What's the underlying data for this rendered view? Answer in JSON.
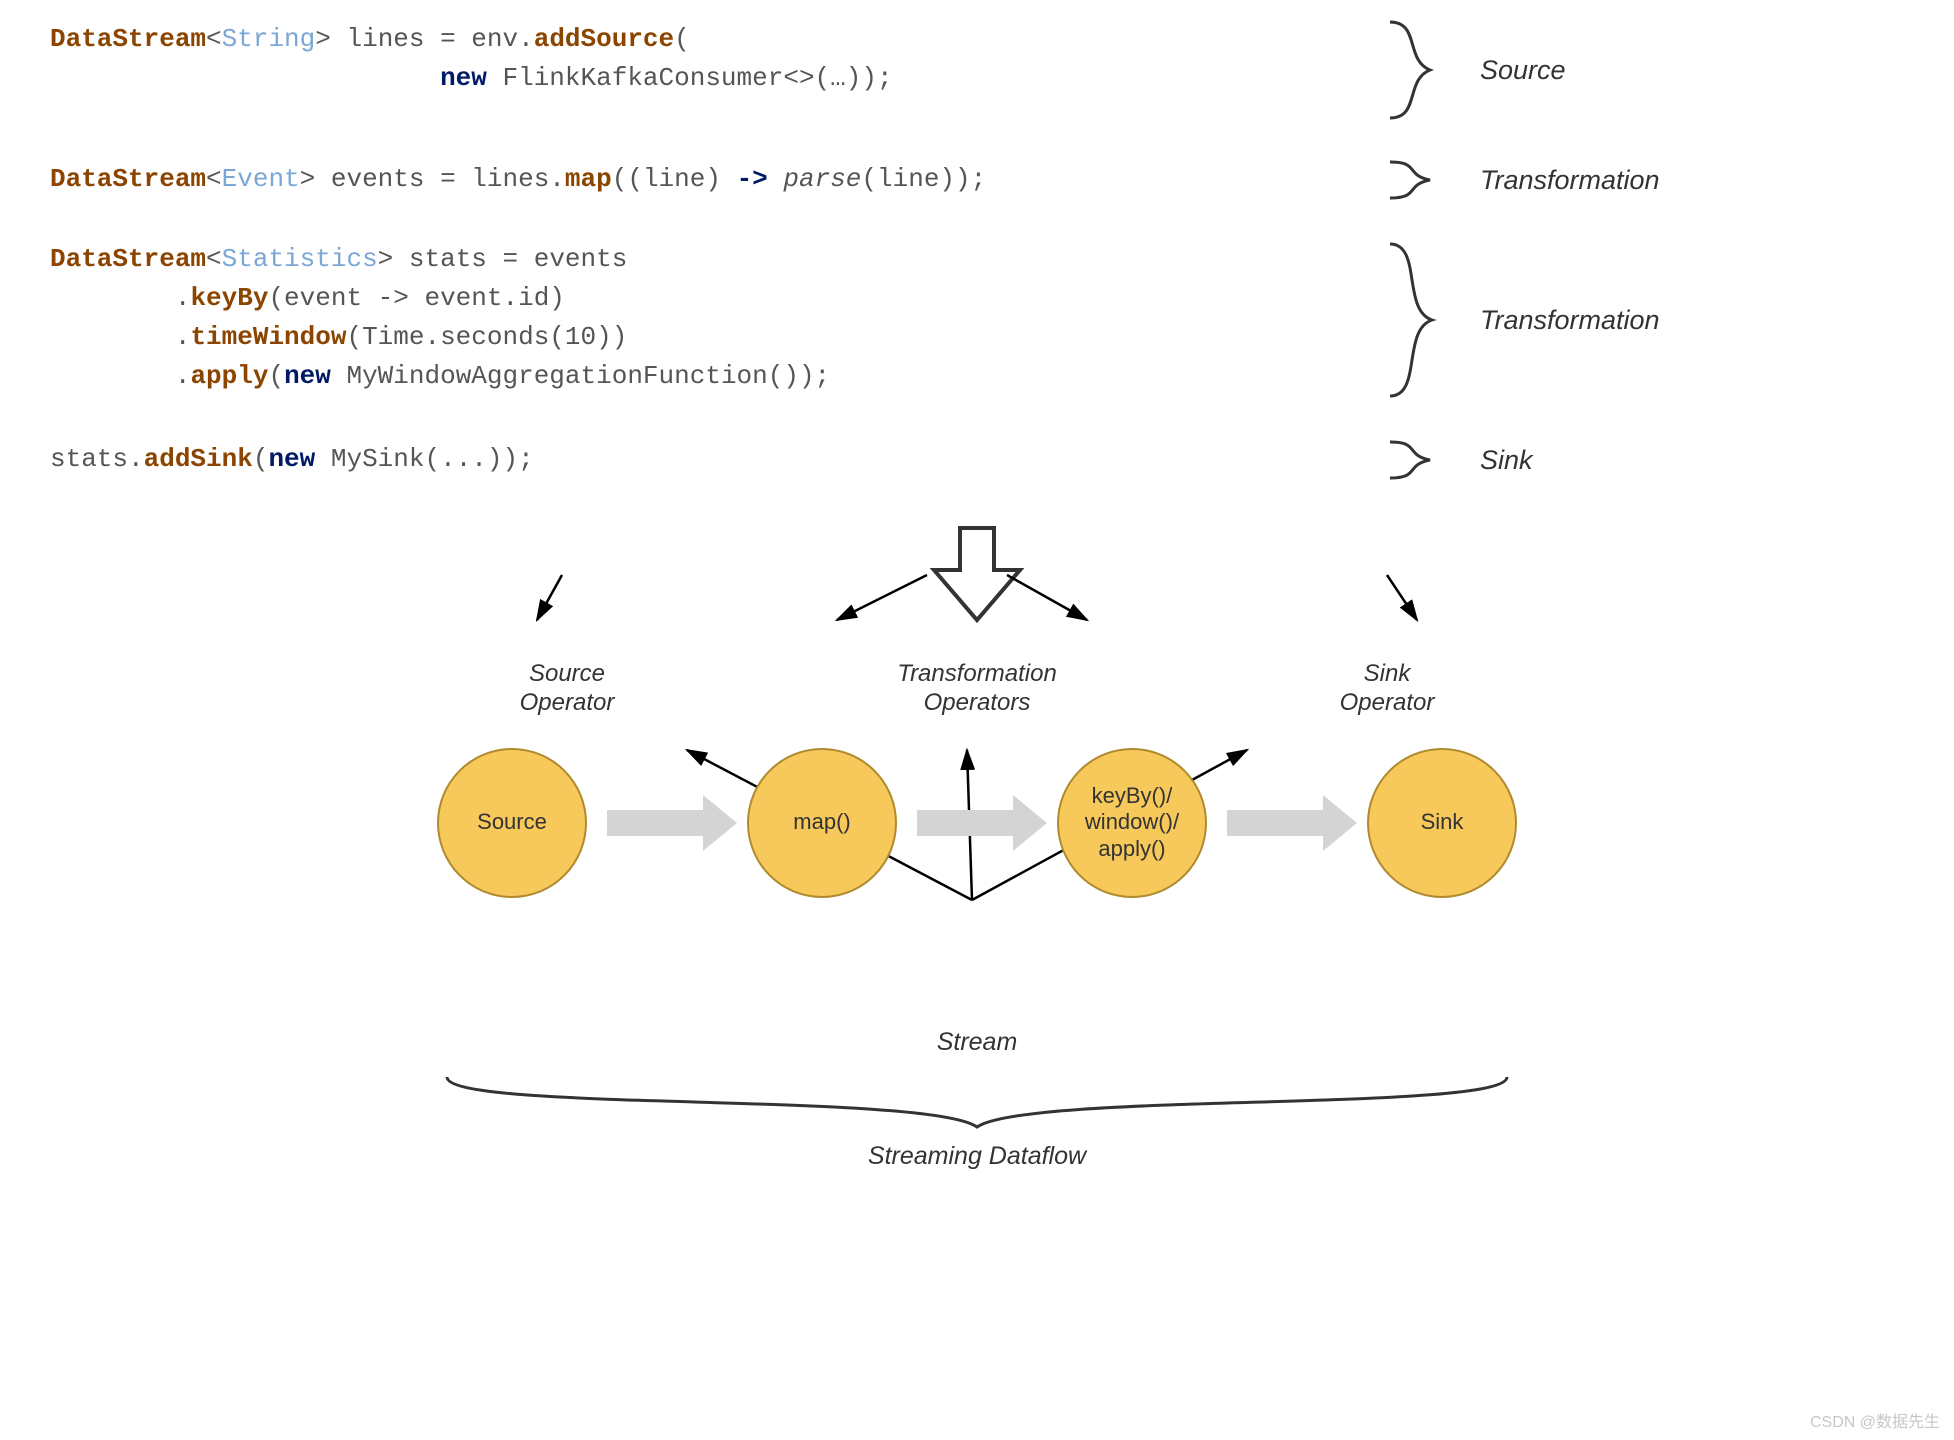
{
  "code": {
    "block1_line1": {
      "pre": "",
      "t1": "DataStream",
      "lt": "<",
      "type": "String",
      "gt": "> ",
      "var": "lines = env.",
      "m1": "addSource",
      "tail": "("
    },
    "block1_line2": {
      "indent": "                         ",
      "kw": "new",
      "rest": " FlinkKafkaConsumer<>(…));"
    },
    "block2_line1": {
      "t1": "DataStream",
      "lt": "<",
      "type": "Event",
      "gt": "> ",
      "var": "events = lines.",
      "m": "map",
      "mid": "((line) ",
      "arrow": "->",
      "sp": " ",
      "fn": "parse",
      "tail": "(line));"
    },
    "block3_line1": {
      "t1": "DataStream",
      "lt": "<",
      "type": "Statistics",
      "gt": "> ",
      "var": "stats = events"
    },
    "block3_line2": {
      "indent": "        .",
      "m": "keyBy",
      "rest": "(event -> event.id)"
    },
    "block3_line3": {
      "indent": "        .",
      "m": "timeWindow",
      "rest": "(Time.seconds(10))"
    },
    "block3_line4": {
      "indent": "        .",
      "m": "apply",
      "open": "(",
      "kw": "new",
      "rest": " MyWindowAggregationFunction());"
    },
    "block4_line1": {
      "pre": "stats.",
      "m": "addSink",
      "open": "(",
      "kw": "new",
      "rest": " MySink(...));"
    }
  },
  "labels": {
    "source": "Source",
    "transformation": "Transformation",
    "sink": "Sink",
    "source_op": "Source\nOperator",
    "transform_ops": "Transformation\nOperators",
    "sink_op": "Sink\nOperator",
    "stream": "Stream",
    "dataflow": "Streaming Dataflow"
  },
  "nodes": {
    "n1": "Source",
    "n2": "map()",
    "n3": "keyBy()/\nwindow()/\napply()",
    "n4": "Sink"
  },
  "watermark": "CSDN @数据先生"
}
